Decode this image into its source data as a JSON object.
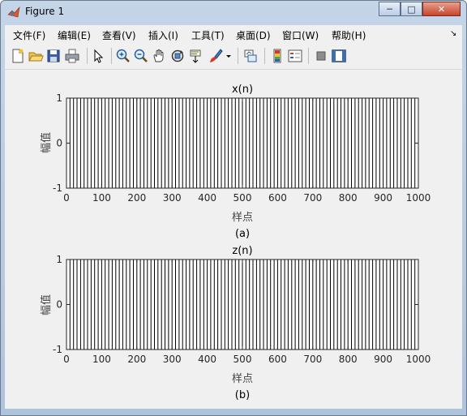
{
  "window": {
    "title": "Figure 1",
    "minimize_glyph": "─",
    "maximize_glyph": "□",
    "close_glyph": "✕"
  },
  "menu": [
    "文件(F)",
    "编辑(E)",
    "查看(V)",
    "插入(I)",
    "工具(T)",
    "桌面(D)",
    "窗口(W)",
    "帮助(H)"
  ],
  "menu_dock_glyph": "↘",
  "toolbar": {
    "icons": [
      "new-figure-icon",
      "open-file-icon",
      "save-icon",
      "print-icon",
      "pointer-icon",
      "zoom-in-icon",
      "zoom-out-icon",
      "pan-icon",
      "rotate-3d-icon",
      "data-cursor-icon",
      "brush-icon",
      "link-plot-icon",
      "colorbar-icon",
      "legend-icon",
      "hide-plot-tools-icon",
      "show-plot-tools-icon"
    ]
  },
  "colors": {
    "line": "#000000",
    "axes_bg": "#ffffff",
    "figure_bg": "#f0f0f0"
  },
  "chart_data": [
    {
      "type": "line",
      "title": "x(n)",
      "xlabel": "样点",
      "ylabel": "幅值",
      "caption": "(a)",
      "xlim": [
        0,
        1000
      ],
      "ylim": [
        -1,
        1
      ],
      "xticks": [
        "0",
        "100",
        "200",
        "300",
        "400",
        "500",
        "600",
        "700",
        "800",
        "900",
        "1000"
      ],
      "yticks": [
        "-1",
        "0",
        "1"
      ],
      "series": [
        {
          "waveform": "square",
          "period": 20,
          "amplitude": 1,
          "x_range": [
            0,
            1000
          ]
        }
      ]
    },
    {
      "type": "line",
      "title": "z(n)",
      "xlabel": "样点",
      "ylabel": "幅值",
      "caption": "(b)",
      "xlim": [
        0,
        1000
      ],
      "ylim": [
        -1,
        1
      ],
      "xticks": [
        "0",
        "100",
        "200",
        "300",
        "400",
        "500",
        "600",
        "700",
        "800",
        "900",
        "1000"
      ],
      "yticks": [
        "-1",
        "0",
        "1"
      ],
      "series": [
        {
          "waveform": "square",
          "period": 20,
          "amplitude": 1,
          "x_range": [
            0,
            1000
          ]
        }
      ]
    }
  ]
}
